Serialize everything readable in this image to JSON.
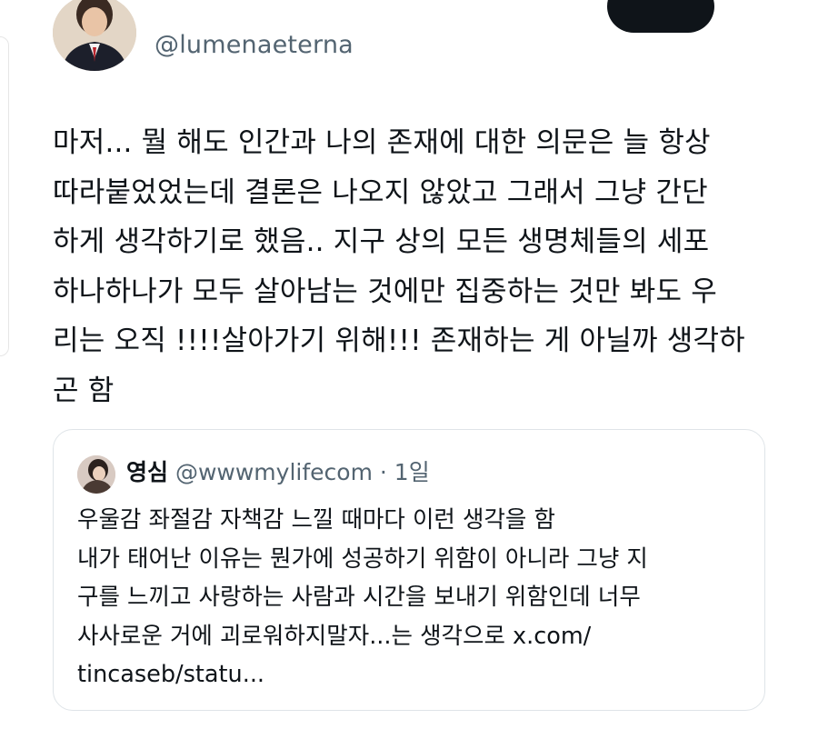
{
  "tweet": {
    "handle": "@lumenaeterna",
    "text": "마저... 뭘 해도 인간과 나의 존재에 대한 의문은 늘 항상\n따라붙었었는데 결론은 나오지 않았고 그래서 그냥 간단\n하게 생각하기로 했음.. 지구 상의 모든 생명체들의 세포\n하나하나가 모두 살아남는 것에만 집중하는  것만 봐도 우\n리는 오직 !!!!살아가기 위해!!! 존재하는 게 아닐까 생각하\n곤 함",
    "avatar_icon": "profile-photo"
  },
  "quote": {
    "name": "영심",
    "handle": "@wwwmylifecom",
    "separator": "·",
    "time": "1일",
    "text": "우울감 좌절감 자책감 느낄 때마다 이런 생각을 함\n내가 태어난 이유는 뭔가에 성공하기 위함이 아니라 그냥 지\n구를 느끼고 사랑하는 사람과 시간을 보내기 위함인데 너무\n사사로운 거에 괴로워하지말자...는 생각으로 x.com/\ntincaseb/statu...",
    "avatar_icon": "profile-photo"
  },
  "colors": {
    "text_primary": "#0f1419",
    "text_secondary": "#536471",
    "border": "#dfe4e8",
    "button_dark": "#0f1419"
  }
}
